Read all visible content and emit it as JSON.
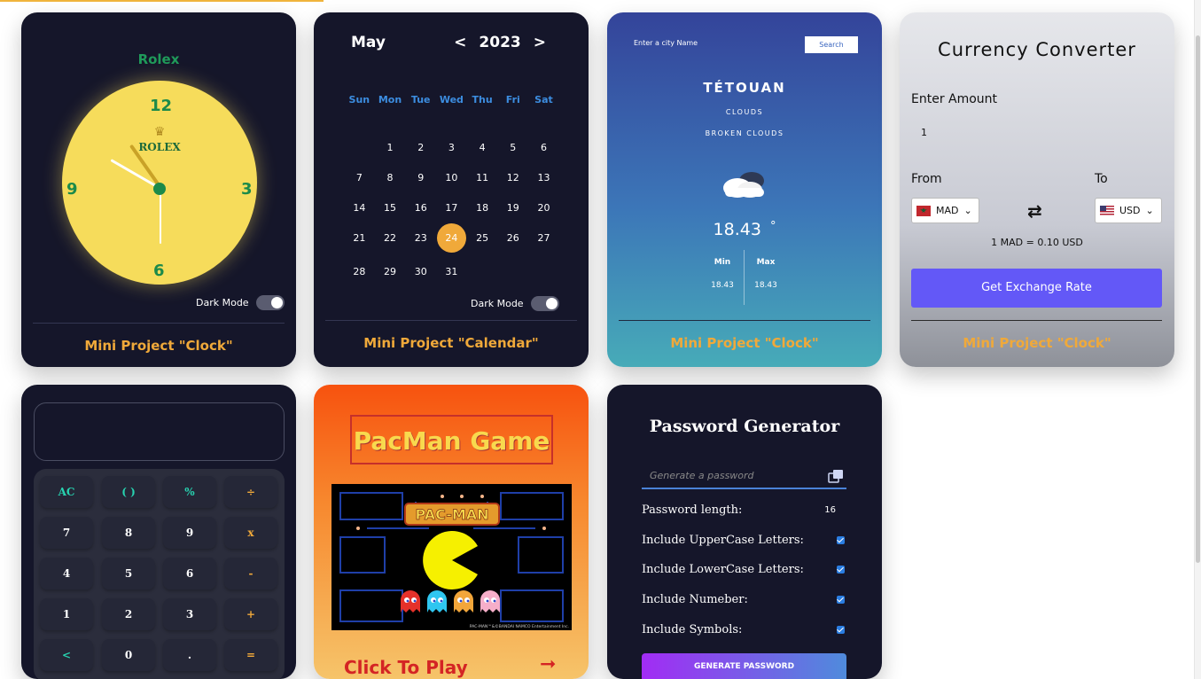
{
  "clock": {
    "brand": "Rolex",
    "dial_brand": "ROLEX",
    "numbers": [
      "12",
      "3",
      "6",
      "9"
    ],
    "dark_mode_label": "Dark Mode",
    "footer": "Mini Project \"Clock\""
  },
  "calendar": {
    "month": "May",
    "prev": "<",
    "year": "2023",
    "next": ">",
    "weekdays": [
      "Sun",
      "Mon",
      "Tue",
      "Wed",
      "Thu",
      "Fri",
      "Sat"
    ],
    "days": [
      "",
      "1",
      "2",
      "3",
      "4",
      "5",
      "6",
      "7",
      "8",
      "9",
      "10",
      "11",
      "12",
      "13",
      "14",
      "15",
      "16",
      "17",
      "18",
      "19",
      "20",
      "21",
      "22",
      "23",
      "24",
      "25",
      "26",
      "27",
      "28",
      "29",
      "30",
      "31"
    ],
    "today": "24",
    "today_color": "#f0a93a",
    "dark_mode_label": "Dark Mode",
    "footer": "Mini Project \"Calendar\""
  },
  "weather": {
    "search_placeholder": "Enter a city Name",
    "search_button": "Search",
    "city": "TÉTOUAN",
    "condition": "CLOUDS",
    "description": "BROKEN CLOUDS",
    "temperature": "18.43",
    "degree": "°",
    "min_label": "Min",
    "max_label": "Max",
    "min_value": "18.43",
    "max_value": "18.43",
    "footer": "Mini Project \"Clock\""
  },
  "currency": {
    "title": "Currency Converter",
    "amount_label": "Enter Amount",
    "amount_value": "1",
    "from_label": "From",
    "to_label": "To",
    "from_currency": "MAD",
    "to_currency": "USD",
    "swap_icon": "⇄",
    "rate_text": "1 MAD = 0.10 USD",
    "button": "Get Exchange Rate",
    "button_color": "#6358f7",
    "footer": "Mini Project \"Clock\""
  },
  "calculator": {
    "keys": [
      [
        "AC",
        "( )",
        "%",
        "÷"
      ],
      [
        "7",
        "8",
        "9",
        "x"
      ],
      [
        "4",
        "5",
        "6",
        "-"
      ],
      [
        "1",
        "2",
        "3",
        "+"
      ],
      [
        "<",
        "0",
        ".",
        "="
      ]
    ]
  },
  "pacman": {
    "title": "PacMan Game",
    "logo": "PAC-MAN",
    "copyright": "PAC-MAN™&©BANDAI NAMCO Entertainment Inc.",
    "play": "Click To Play",
    "arrow_icon": "➞"
  },
  "password": {
    "title": "Password Generator",
    "placeholder": "Generate a password",
    "length_label": "Password length:",
    "length_value": "16",
    "upper_label": "Include UpperCase Letters:",
    "lower_label": "Include LowerCase Letters:",
    "number_label": "Include Numeber:",
    "symbol_label": "Include Symbols:",
    "button": "GENERATE PASSWORD"
  }
}
